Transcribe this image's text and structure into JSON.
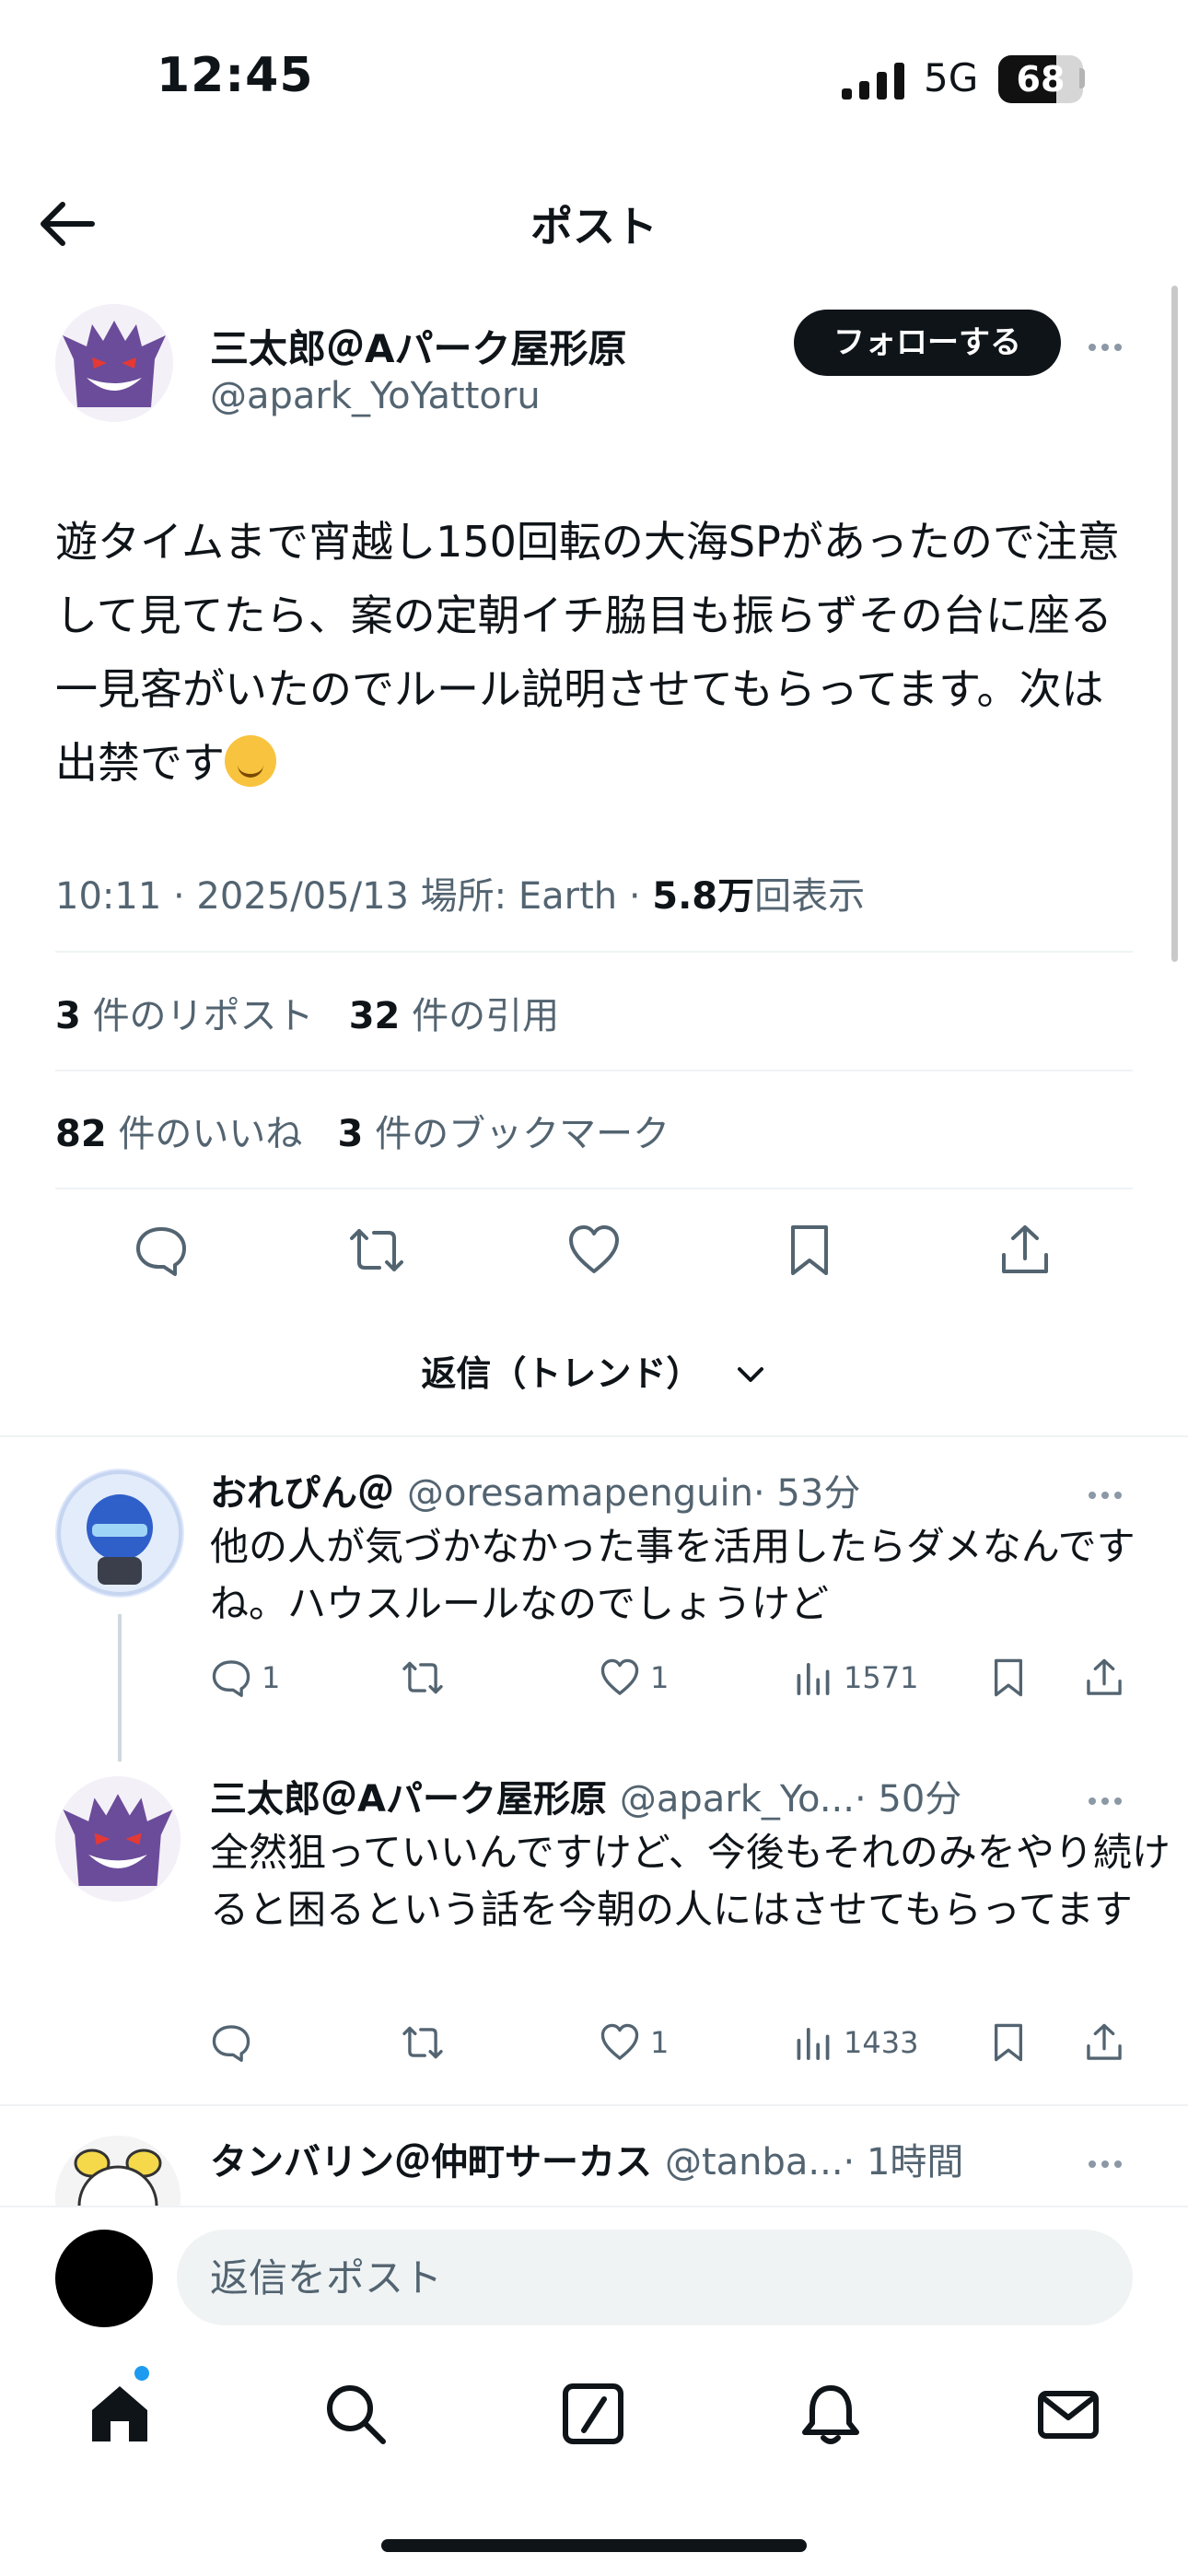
{
  "status_bar": {
    "time": "12:45",
    "network": "5G",
    "battery": "68",
    "battery_level": 0.68
  },
  "header": {
    "title": "ポスト"
  },
  "post": {
    "author_name": "三太郎＠Aパーク屋形原",
    "author_handle": "@apark_YoYattoru",
    "follow_label": "フォローする",
    "text": "遊タイムまで宵越し150回転の大海SPがあったので注意して見てたら、案の定朝イチ脇目も振らずその台に座る一見客がいたのでルール説明させてもらってます。次は出禁です",
    "meta_prefix": "10:11 · 2025/05/13 場所: Earth · ",
    "view_count": "5.8万",
    "view_suffix": "回表示",
    "reposts_count": "3",
    "reposts_label": "件のリポスト",
    "quotes_count": "32",
    "quotes_label": "件の引用",
    "likes_count": "82",
    "likes_label": "件のいいね",
    "bookmarks_count": "3",
    "bookmarks_label": "件のブックマーク"
  },
  "reply_filter": {
    "label": "返信（トレンド）"
  },
  "replies": [
    {
      "name": "おれぴん＠",
      "handle": "@oresamapenguin",
      "time": "· 53分",
      "text": "他の人が気づかなかった事を活用したらダメなんですね。ハウスルールなのでしょうけど",
      "reply_count": "1",
      "retweet_count": "",
      "like_count": "1",
      "view_count": "1571"
    },
    {
      "name": "三太郎＠Aパーク屋形原",
      "handle": "@apark_Yo...",
      "time": "· 50分",
      "text": "全然狙っていいんですけど、今後もそれのみをやり続けると困るという話を今朝の人にはさせてもらってます",
      "reply_count": "",
      "retweet_count": "",
      "like_count": "1",
      "view_count": "1433"
    },
    {
      "name": "タンバリン＠仲町サーカス",
      "handle": "@tanba...",
      "time": "· 1時間"
    }
  ],
  "composer": {
    "placeholder": "返信をポスト"
  },
  "colors": {
    "accent": "#1d9bf0",
    "text": "#0f1419",
    "muted": "#536471",
    "divider": "#eff3f4"
  },
  "icons": [
    "back-arrow-icon",
    "more-icon",
    "reply-icon",
    "retweet-icon",
    "like-icon",
    "bookmark-icon",
    "share-icon",
    "views-icon",
    "chevron-down-icon",
    "home-icon",
    "search-icon",
    "compose-icon",
    "bell-icon",
    "mail-icon"
  ]
}
